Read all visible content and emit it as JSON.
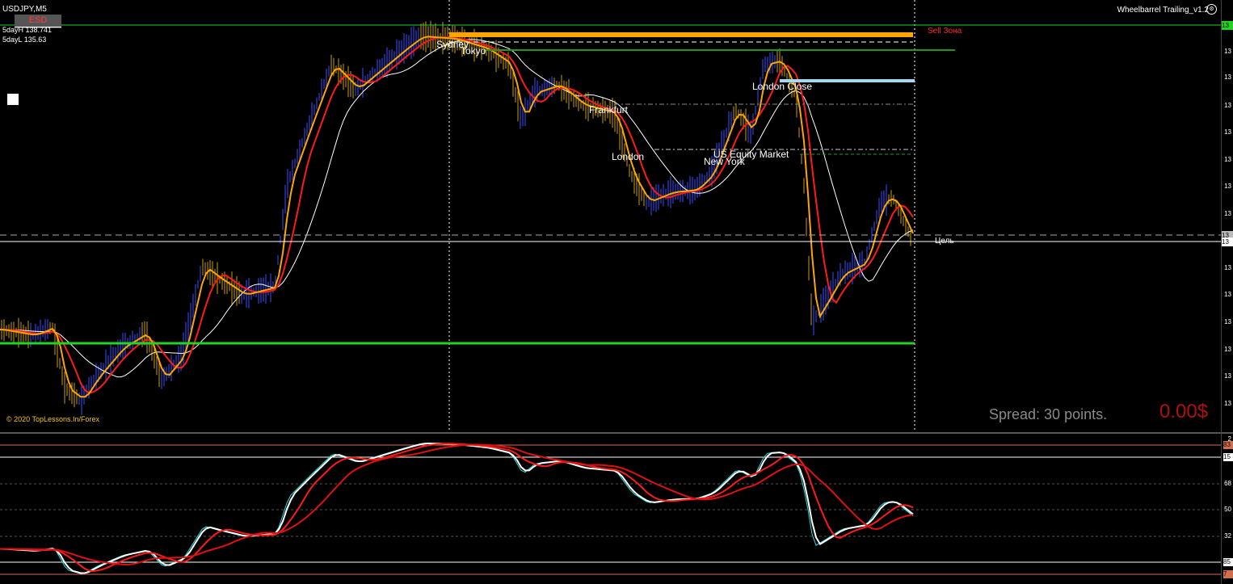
{
  "header": {
    "symbol": "USDJPY,M5",
    "esd_label": "ESD",
    "high_label": "5dayH 138.741",
    "low_label": "5dayL 135.63",
    "indicator_name": "Wheelbarrel Trailing_v1.2",
    "gear_glyph": "⚙"
  },
  "labels": {
    "sell_zone": "Sell Зона",
    "target": "Цель",
    "copyright": "© 2020 TopLessons.In/Forex",
    "spread": "Spread: 30 points.",
    "profit": "0.00$"
  },
  "sessions": [
    {
      "name": "Sydney"
    },
    {
      "name": "Tokyo"
    },
    {
      "name": "Frankfurt"
    },
    {
      "name": "London"
    },
    {
      "name": "New York"
    },
    {
      "name": "US Equity Market"
    },
    {
      "name": "London Close"
    }
  ],
  "price_scale": {
    "ticks": [
      "13",
      "13",
      "13",
      "13",
      "13",
      "13",
      "13",
      "13",
      "13",
      "13",
      "13",
      "13",
      "13",
      "13",
      "13"
    ],
    "tags": [
      "13",
      "13",
      "13"
    ]
  },
  "osc_scale": {
    "ticks": [
      "2",
      "68",
      "50",
      "32",
      "7"
    ],
    "tags": [
      "83",
      "15",
      "85"
    ]
  },
  "colors": {
    "background": "#000000",
    "candle_up": "#3a4cff",
    "candle_down": "#c8a000",
    "ema_fast": "#ffa500",
    "ema_slow": "#ff1a1a",
    "ma_long": "#ffffff",
    "support_line": "#22d422",
    "resistance_line": "#ffa500",
    "sell_zone_text": "#ff2a2a"
  },
  "icons": {
    "gear": "gear-icon"
  }
}
